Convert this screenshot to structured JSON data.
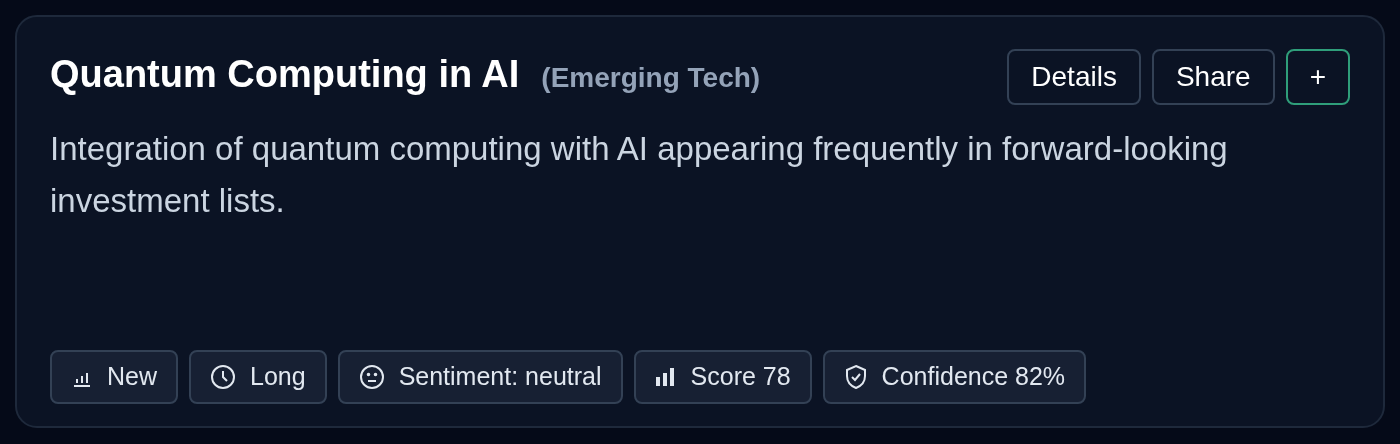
{
  "card": {
    "title": "Quantum Computing in AI",
    "category": "(Emerging Tech)",
    "description": "Integration of quantum computing with AI appearing frequently in forward-looking investment lists.",
    "actions": [
      {
        "label": "Details",
        "kind": "outline"
      },
      {
        "label": "Share",
        "kind": "outline"
      },
      {
        "label": "+",
        "kind": "accent"
      }
    ],
    "tags": [
      {
        "label": "New",
        "kind": "bars-thin"
      },
      {
        "label": "Long",
        "kind": "clock"
      },
      {
        "label": "Sentiment: neutral",
        "kind": "face"
      },
      {
        "label": "Score 78",
        "kind": "bars"
      },
      {
        "label": "Confidence 82%",
        "kind": "shield"
      }
    ]
  }
}
